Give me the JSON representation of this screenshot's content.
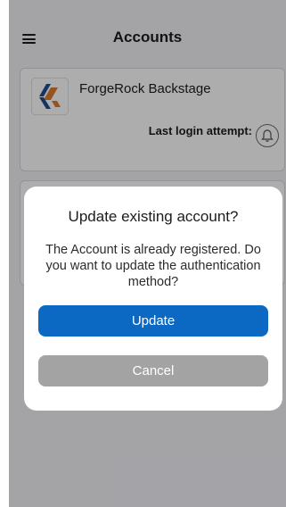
{
  "header": {
    "title": "Accounts",
    "menu_icon": "hamburger-menu-icon"
  },
  "accounts": [
    {
      "issuer": "ForgeRock Backstage",
      "last_login_label": "Last login attempt:",
      "logo_icon": "forgerock-logo",
      "status_icon": "bell-icon"
    }
  ],
  "dialog": {
    "title": "Update existing account?",
    "message": "The Account is already registered. Do you want to update the authentication method?",
    "update_label": "Update",
    "cancel_label": "Cancel"
  },
  "colors": {
    "primary": "#0b69c4",
    "cancel": "#a3a3a3",
    "logo_blue": "#1f4e8f",
    "logo_orange": "#e07a2b"
  }
}
